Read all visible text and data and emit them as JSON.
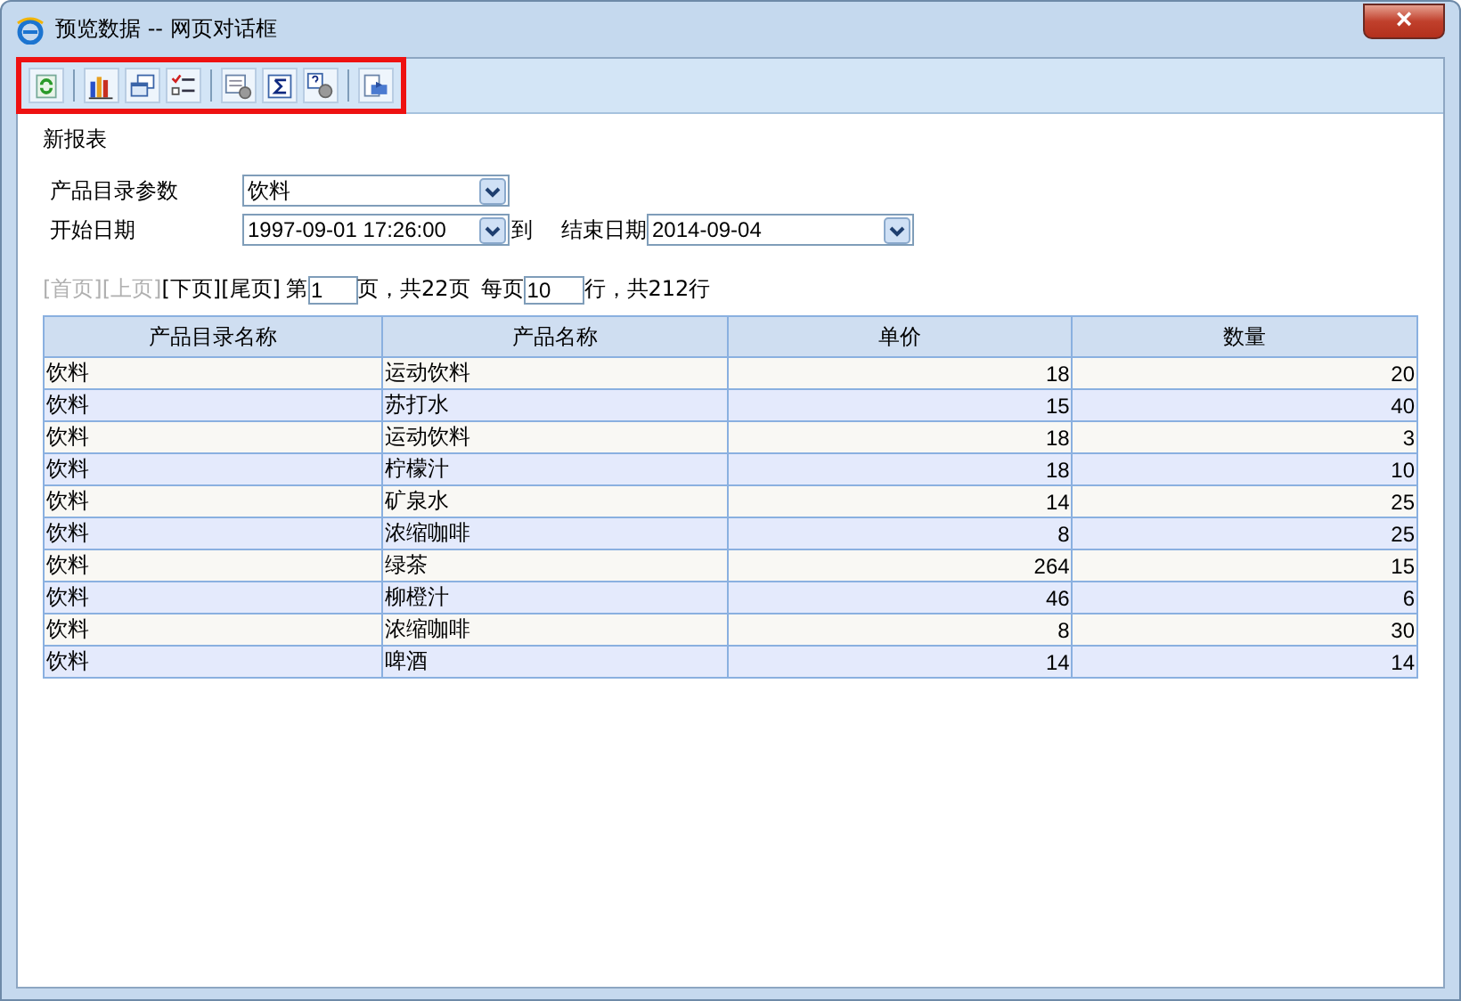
{
  "window": {
    "title": "预览数据 -- 网页对话框",
    "close": "×"
  },
  "toolbar": {
    "highlighted": true
  },
  "report": {
    "title": "新报表"
  },
  "params": [
    {
      "label": "产品目录参数",
      "value": "饮料"
    },
    {
      "label": "开始日期",
      "value": "1997-09-01 17:26:00",
      "joiner": "到",
      "end_label": "结束日期",
      "end_value": "2014-09-04"
    }
  ],
  "pager": {
    "links": [
      {
        "label": "[首页]",
        "disabled": true
      },
      {
        "label": "[上页]",
        "disabled": true
      },
      {
        "label": "[下页]",
        "disabled": false
      },
      {
        "label": "[尾页]",
        "disabled": false
      }
    ],
    "page_prefix": "第",
    "page": "1",
    "page_suffix": "页，共22页",
    "per_prefix": "每页",
    "per_page": "10",
    "per_suffix": "行，共212行"
  },
  "table": {
    "columns": [
      "产品目录名称",
      "产品名称",
      "单价",
      "数量"
    ],
    "rows": [
      [
        "饮料",
        "运动饮料",
        "18",
        "20"
      ],
      [
        "饮料",
        "苏打水",
        "15",
        "40"
      ],
      [
        "饮料",
        "运动饮料",
        "18",
        "3"
      ],
      [
        "饮料",
        "柠檬汁",
        "18",
        "10"
      ],
      [
        "饮料",
        "矿泉水",
        "14",
        "25"
      ],
      [
        "饮料",
        "浓缩咖啡",
        "8",
        "25"
      ],
      [
        "饮料",
        "绿茶",
        "264",
        "15"
      ],
      [
        "饮料",
        "柳橙汁",
        "46",
        "6"
      ],
      [
        "饮料",
        "浓缩咖啡",
        "8",
        "30"
      ],
      [
        "饮料",
        "啤酒",
        "14",
        "14"
      ]
    ]
  }
}
